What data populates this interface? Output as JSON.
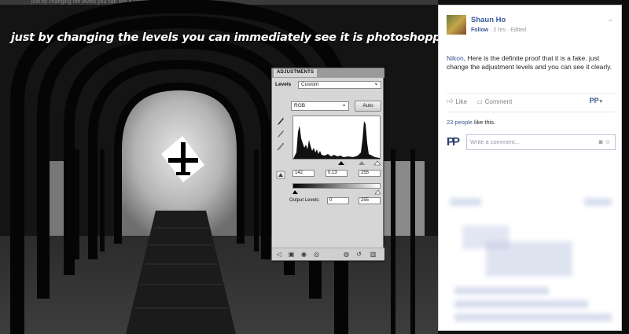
{
  "photo": {
    "top_strip_text": "just by changing the levels you can see it clearly",
    "caption": "just by changing the levels you can immediately see it is photoshopped"
  },
  "photoshop": {
    "panel_tab": "ADJUSTMENTS",
    "levels_label": "Levels",
    "preset_value": "Custom",
    "channel_value": "RGB",
    "auto_button": "Auto",
    "input_levels": [
      "142",
      "0.13",
      "255"
    ],
    "output_label": "Output Levels:",
    "output_levels": [
      "0",
      "255"
    ]
  },
  "facebook": {
    "author": "Shaun Ho",
    "follow_label": "Follow",
    "timestamp": "2 hrs",
    "edited_label": "Edited",
    "post_tag": "Nikon",
    "post_text": ", Here is the definite proof that it is a fake. just change the adjustment levels and you can see it clearly.",
    "like_label": "Like",
    "comment_label": "Comment",
    "page_badge": "PP",
    "likes_count": "23 people",
    "likes_suffix": " like this.",
    "comment_avatar": "PP",
    "comment_placeholder": "Write a comment...",
    "colors": {
      "link": "#3b5998",
      "muted": "#90949c"
    }
  }
}
